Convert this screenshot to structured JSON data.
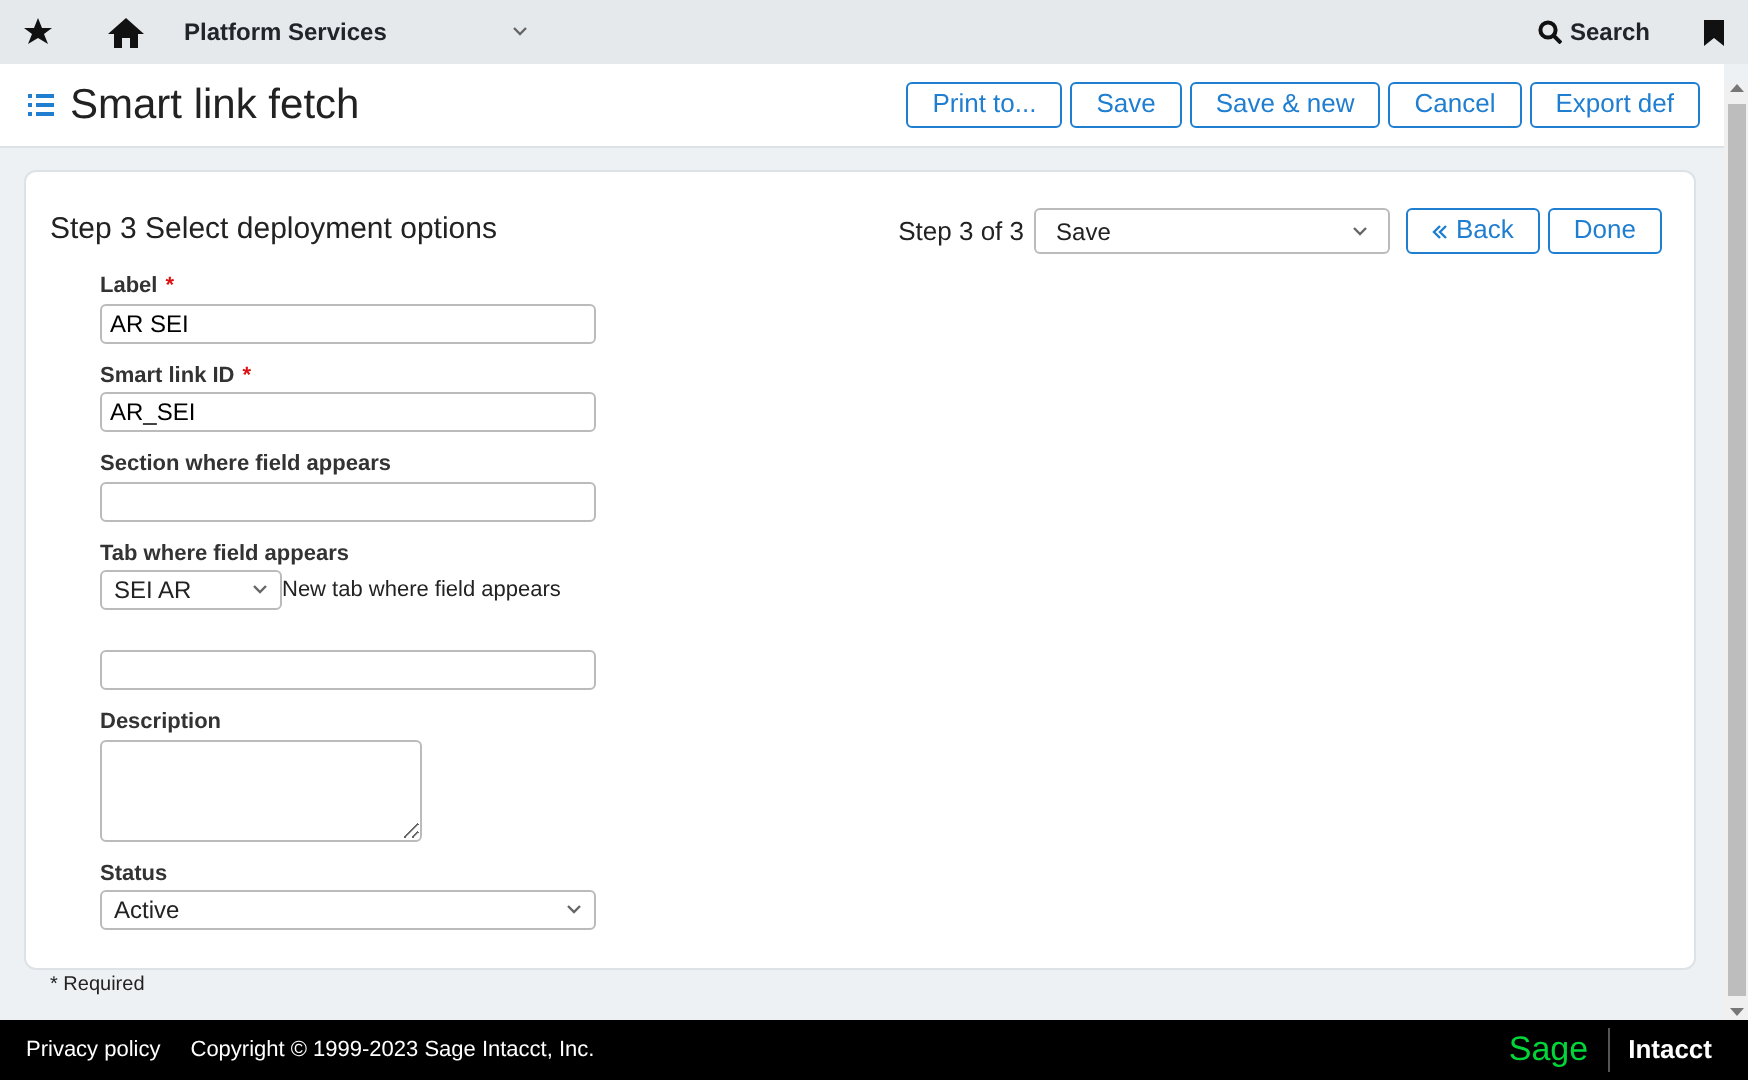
{
  "topbar": {
    "module": "Platform Services",
    "search": "Search"
  },
  "header": {
    "title": "Smart link fetch",
    "buttons": [
      "Print to...",
      "Save",
      "Save & new",
      "Cancel",
      "Export def"
    ]
  },
  "step": {
    "title": "Step 3 Select deployment options",
    "counter": "Step 3 of 3",
    "action": "Save",
    "back": "Back",
    "done": "Done"
  },
  "fields": [
    {
      "kind": "text",
      "label": "Label",
      "required_mark": "*",
      "value": "AR SEI"
    },
    {
      "kind": "text",
      "label": "Smart link ID",
      "required_mark": "*",
      "value": "AR_SEI"
    },
    {
      "kind": "text",
      "label": "Section where field appears"
    },
    {
      "kind": "tabselect",
      "label": "Tab where field appears",
      "value": "SEI AR",
      "note": "New tab where field appears"
    },
    {
      "kind": "text"
    },
    {
      "kind": "textarea",
      "label": "Description"
    },
    {
      "kind": "select",
      "label": "Status",
      "value": "Active"
    }
  ],
  "required_note": "* Required",
  "footer": {
    "privacy": "Privacy policy",
    "copyright": "Copyright © 1999-2023 Sage Intacct, Inc.",
    "brand": "Sage",
    "product": "Intacct"
  }
}
